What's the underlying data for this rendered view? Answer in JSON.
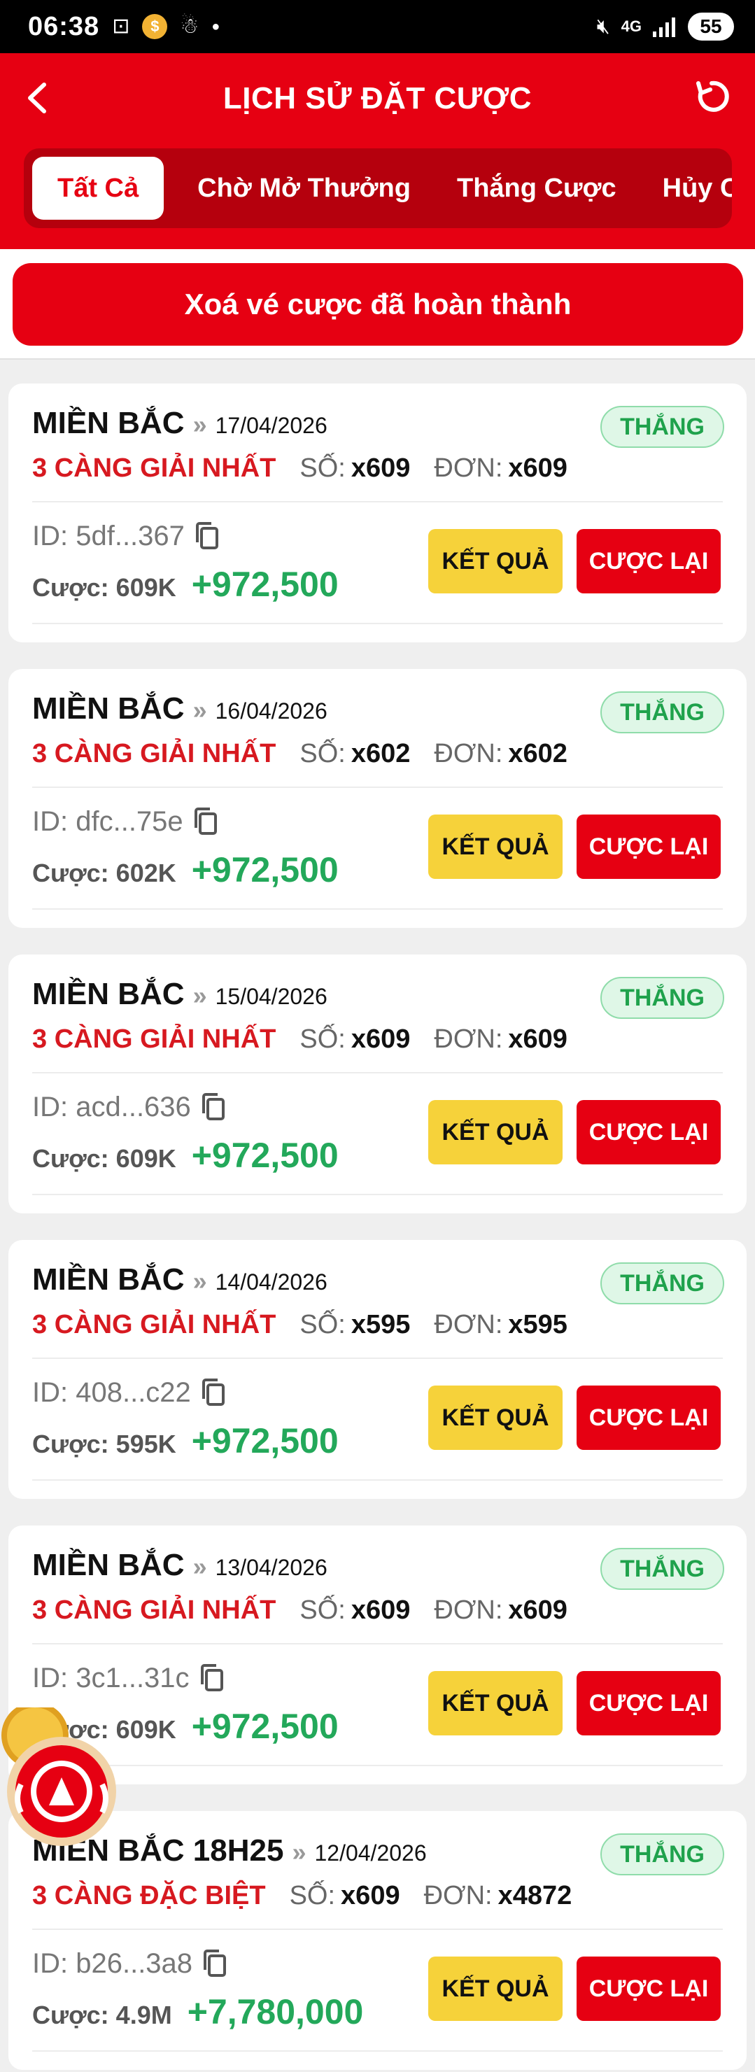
{
  "status": {
    "time": "06:38",
    "battery": "55",
    "network": "4G"
  },
  "header": {
    "title": "LỊCH SỬ ĐẶT CƯỢC"
  },
  "tabs": [
    {
      "label": "Tất Cả",
      "active": true
    },
    {
      "label": "Chờ Mở Thưởng",
      "active": false
    },
    {
      "label": "Thắng Cược",
      "active": false
    },
    {
      "label": "Hủy Cư",
      "active": false
    }
  ],
  "clear_button": "Xoá vé cược đã hoàn thành",
  "labels": {
    "number": "SỐ:",
    "order": "ĐƠN:",
    "result_btn": "KẾT QUẢ",
    "rebet_btn": "CƯỢC LẠI",
    "separator": "»"
  },
  "bets": [
    {
      "region": "MIỀN BẮC",
      "date": "17/04/2026",
      "status": "THẮNG",
      "type": "3 CÀNG GIẢI NHẤT",
      "number": "x609",
      "order": "x609",
      "id": "ID: 5df...367",
      "stake": "Cược: 609K",
      "win": "+972,500"
    },
    {
      "region": "MIỀN BẮC",
      "date": "16/04/2026",
      "status": "THẮNG",
      "type": "3 CÀNG GIẢI NHẤT",
      "number": "x602",
      "order": "x602",
      "id": "ID: dfc...75e",
      "stake": "Cược: 602K",
      "win": "+972,500"
    },
    {
      "region": "MIỀN BẮC",
      "date": "15/04/2026",
      "status": "THẮNG",
      "type": "3 CÀNG GIẢI NHẤT",
      "number": "x609",
      "order": "x609",
      "id": "ID: acd...636",
      "stake": "Cược: 609K",
      "win": "+972,500"
    },
    {
      "region": "MIỀN BẮC",
      "date": "14/04/2026",
      "status": "THẮNG",
      "type": "3 CÀNG GIẢI NHẤT",
      "number": "x595",
      "order": "x595",
      "id": "ID: 408...c22",
      "stake": "Cược: 595K",
      "win": "+972,500"
    },
    {
      "region": "MIỀN BẮC",
      "date": "13/04/2026",
      "status": "THẮNG",
      "type": "3 CÀNG GIẢI NHẤT",
      "number": "x609",
      "order": "x609",
      "id": "ID: 3c1...31c",
      "stake": "Cược: 609K",
      "win": "+972,500"
    },
    {
      "region": "MIỀN BẮC 18H25",
      "date": "12/04/2026",
      "status": "THẮNG",
      "type": "3 CÀNG ĐẶC BIỆT",
      "number": "x609",
      "order": "x4872",
      "id": "ID: b26...3a8",
      "stake": "Cược: 4.9M",
      "win": "+7,780,000"
    }
  ],
  "colors": {
    "brand_red": "#e60012",
    "win_green": "#23a85a",
    "result_yellow": "#f6d23a"
  }
}
